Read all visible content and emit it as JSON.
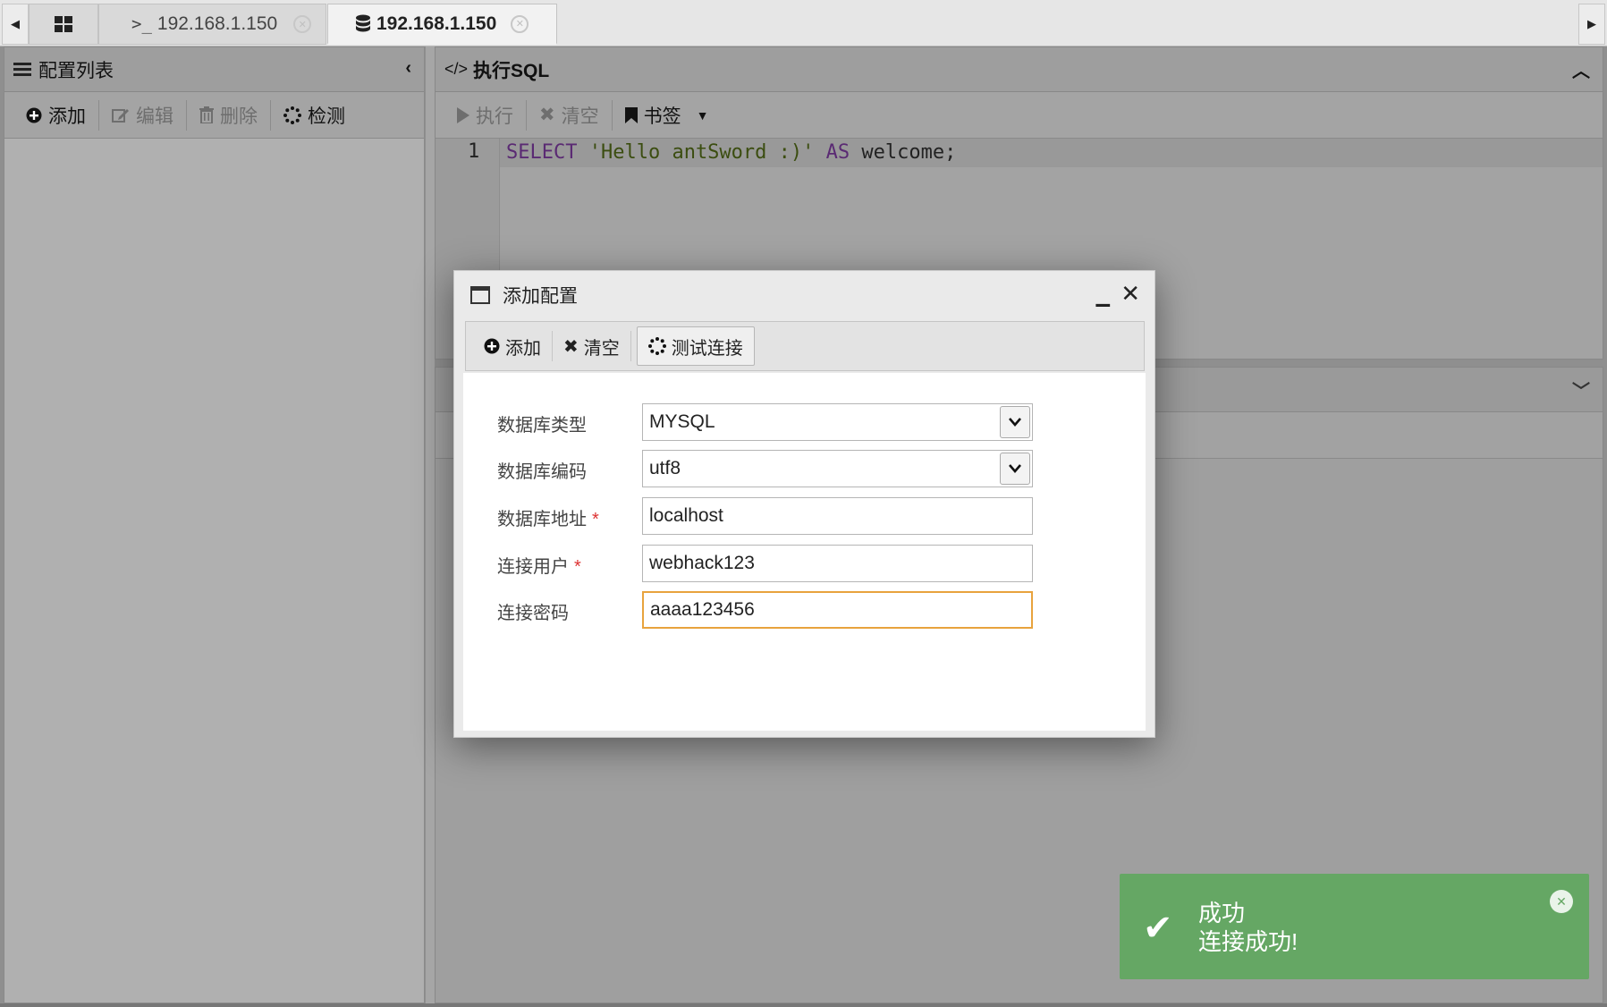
{
  "tabs": {
    "home_icon": "grid-icon",
    "items": [
      {
        "label": "192.168.1.150",
        "icon": "terminal-icon"
      },
      {
        "label": "192.168.1.150",
        "icon": "database-icon"
      }
    ]
  },
  "left_panel": {
    "title": "配置列表",
    "toolbar": {
      "add": "添加",
      "edit": "编辑",
      "delete": "删除",
      "check": "检测"
    }
  },
  "sql_panel": {
    "title": "执行SQL",
    "title_prefix": "</>",
    "toolbar": {
      "execute": "执行",
      "clear": "清空",
      "bookmark": "书签"
    },
    "editor": {
      "line_number": "1",
      "code_kw1": "SELECT",
      "code_str": "'Hello antSword :)'",
      "code_kw2": "AS",
      "code_ident": "welcome;"
    }
  },
  "dialog": {
    "title": "添加配置",
    "toolbar": {
      "add": "添加",
      "clear": "清空",
      "test": "测试连接"
    },
    "form": {
      "db_type_label": "数据库类型",
      "db_type_value": "MYSQL",
      "db_encoding_label": "数据库编码",
      "db_encoding_value": "utf8",
      "db_host_label": "数据库地址",
      "db_host_value": "localhost",
      "db_user_label": "连接用户",
      "db_user_value": "webhack123",
      "db_pass_label": "连接密码",
      "db_pass_value": "aaaa123456",
      "required_mark": "*"
    }
  },
  "toast": {
    "title": "成功",
    "message": "连接成功!",
    "color": "#65a764"
  }
}
